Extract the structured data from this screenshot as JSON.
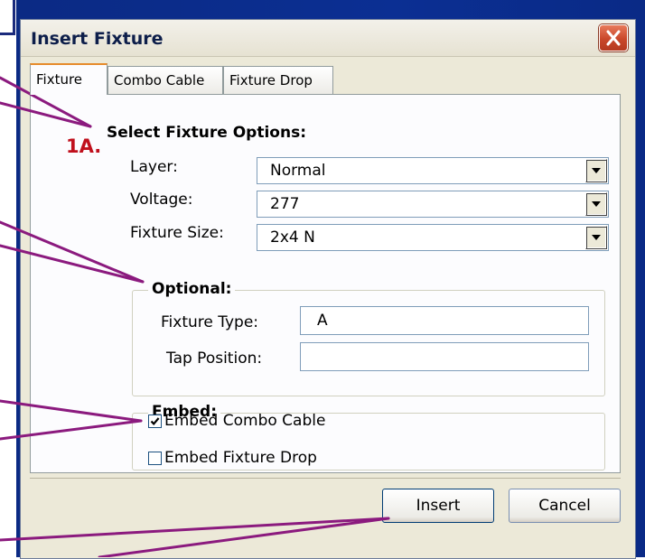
{
  "dialog": {
    "title": "Insert Fixture",
    "close_icon": "close-icon"
  },
  "tabs": [
    {
      "label": "Fixture",
      "active": true
    },
    {
      "label": "Combo Cable",
      "active": false
    },
    {
      "label": "Fixture Drop",
      "active": false
    }
  ],
  "annotation": {
    "step": "1A."
  },
  "section": {
    "heading": "Select Fixture Options:"
  },
  "fields": {
    "layer": {
      "label": "Layer:",
      "value": "Normal"
    },
    "voltage": {
      "label": "Voltage:",
      "value": "277"
    },
    "fixture_size": {
      "label": "Fixture Size:",
      "value": "2x4 N"
    }
  },
  "optional": {
    "legend": "Optional:",
    "fixture_type": {
      "label": "Fixture Type:",
      "value": "A"
    },
    "tap_position": {
      "label": "Tap Position:",
      "value": ""
    }
  },
  "embed": {
    "legend": "Embed:",
    "combo_cable": {
      "label": "Embed Combo Cable",
      "checked": true
    },
    "fixture_drop": {
      "label": "Embed Fixture Drop",
      "checked": false
    }
  },
  "buttons": {
    "insert": "Insert",
    "cancel": "Cancel"
  },
  "colors": {
    "frame_blue": "#0b2f93",
    "dialog_bg": "#ece9d8",
    "annotation_line": "#8b1a7e",
    "step_red": "#c0101c",
    "close_red": "#c9472a"
  }
}
